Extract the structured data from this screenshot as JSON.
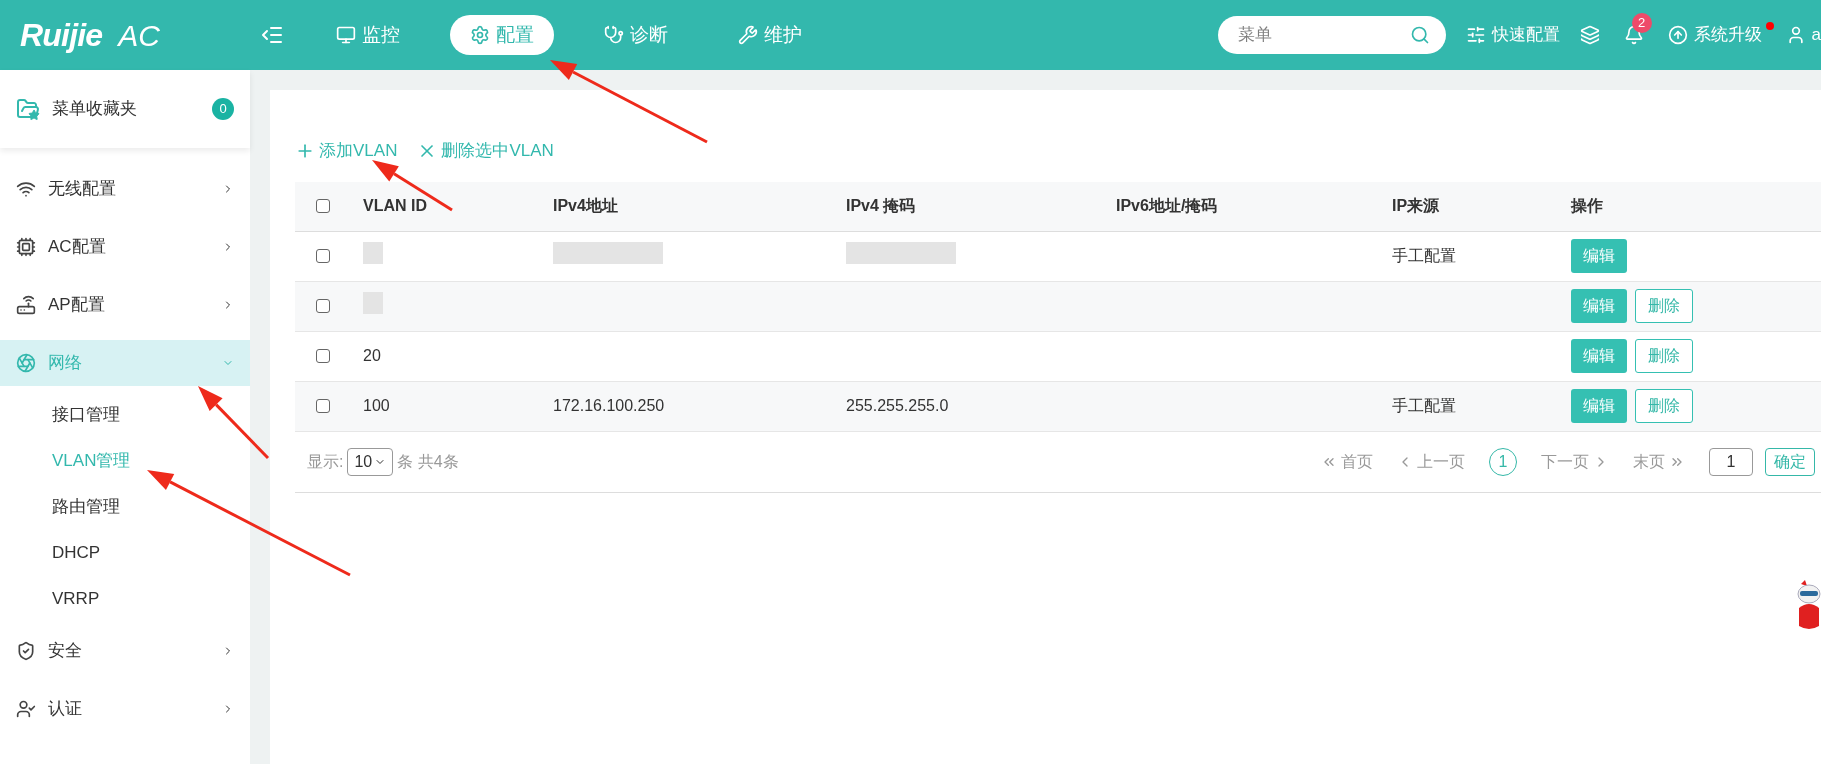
{
  "header": {
    "logo": "Ruijie",
    "product": "AC",
    "nav": [
      {
        "label": "监控",
        "selected": false
      },
      {
        "label": "配置",
        "selected": true
      },
      {
        "label": "诊断",
        "selected": false
      },
      {
        "label": "维护",
        "selected": false
      }
    ],
    "search": {
      "placeholder": "菜单"
    },
    "quick_config": "快速配置",
    "notifications": "2",
    "upgrade": "系统升级",
    "upgrade_alert": true,
    "user": "a"
  },
  "sidebar": {
    "favorites": {
      "label": "菜单收藏夹",
      "count": "0"
    },
    "items": [
      {
        "label": "无线配置",
        "expanded": false
      },
      {
        "label": "AC配置",
        "expanded": false
      },
      {
        "label": "AP配置",
        "expanded": false
      },
      {
        "label": "网络",
        "expanded": true,
        "children": [
          {
            "label": "接口管理",
            "selected": false
          },
          {
            "label": "VLAN管理",
            "selected": true
          },
          {
            "label": "路由管理",
            "selected": false
          },
          {
            "label": "DHCP",
            "selected": false
          },
          {
            "label": "VRRP",
            "selected": false
          }
        ]
      },
      {
        "label": "安全",
        "expanded": false
      },
      {
        "label": "认证",
        "expanded": false
      }
    ]
  },
  "toolbar": {
    "add": "添加VLAN",
    "delete": "删除选中VLAN"
  },
  "table": {
    "all_checked": false,
    "columns": [
      "VLAN ID",
      "IPv4地址",
      "IPv4 掩码",
      "IPv6地址/掩码",
      "IP来源",
      "操作"
    ],
    "rows": [
      {
        "checked": false,
        "cells": [
          {
            "redacted": true
          },
          {
            "redacted": true
          },
          {
            "redacted": true
          },
          {},
          {
            "text": "手工配置"
          }
        ],
        "actions": [
          "编辑"
        ]
      },
      {
        "checked": false,
        "cells": [
          {
            "redacted": true
          },
          {},
          {},
          {},
          {}
        ],
        "actions": [
          "编辑",
          "删除"
        ]
      },
      {
        "checked": false,
        "cells": [
          {
            "text": "20"
          },
          {},
          {},
          {},
          {}
        ],
        "actions": [
          "编辑",
          "删除"
        ]
      },
      {
        "checked": false,
        "cells": [
          {
            "text": "100"
          },
          {
            "text": "172.16.100.250"
          },
          {
            "text": "255.255.255.0"
          },
          {},
          {
            "text": "手工配置"
          }
        ],
        "actions": [
          "编辑",
          "删除"
        ]
      }
    ]
  },
  "pagination": {
    "show_label": "显示:",
    "page_size": "10",
    "total": "条 共4条",
    "first": "首页",
    "prev": "上一页",
    "pages": [
      {
        "label": "1",
        "selected": true
      }
    ],
    "next": "下一页",
    "last": "末页",
    "jump_value": "1",
    "confirm": "确定"
  },
  "annotations": [
    {
      "kind": "arrow"
    },
    {
      "kind": "arrow"
    },
    {
      "kind": "arrow"
    },
    {
      "kind": "arrow"
    }
  ]
}
